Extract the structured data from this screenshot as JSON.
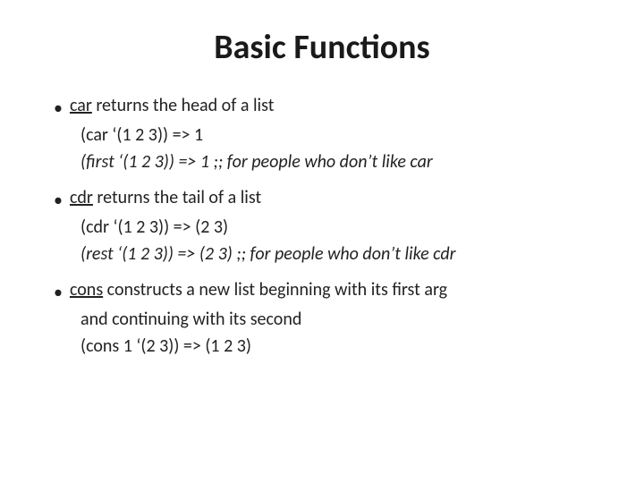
{
  "title": "Basic Functions",
  "bullets": [
    {
      "id": "car",
      "keyword": "car",
      "keyword_underline": true,
      "text_after_keyword": " returns the head of a list",
      "lines": [
        {
          "text": "(car ‘(1 2 3)) => 1",
          "italic": false
        },
        {
          "text": "(first ‘(1 2 3)) => 1  ;; for people who don’t like car",
          "italic": true
        }
      ]
    },
    {
      "id": "cdr",
      "keyword": "cdr",
      "keyword_underline": true,
      "text_after_keyword": " returns the tail of a list",
      "lines": [
        {
          "text": "(cdr ‘(1 2 3)) => (2 3)",
          "italic": false
        },
        {
          "text": "(rest ‘(1 2 3)) => (2 3) ;; for people who don’t like cdr",
          "italic": true
        }
      ]
    },
    {
      "id": "cons",
      "keyword": "cons",
      "keyword_underline": true,
      "text_after_keyword": " constructs a new list beginning with its first arg",
      "text_continuation": "and continuing with its second",
      "lines": [
        {
          "text": "(cons 1 ‘(2 3)) => (1 2 3)",
          "italic": false
        }
      ]
    }
  ],
  "colors": {
    "background": "#ffffff",
    "title": "#1a1a1a",
    "body": "#222222",
    "keyword": "#222222"
  }
}
